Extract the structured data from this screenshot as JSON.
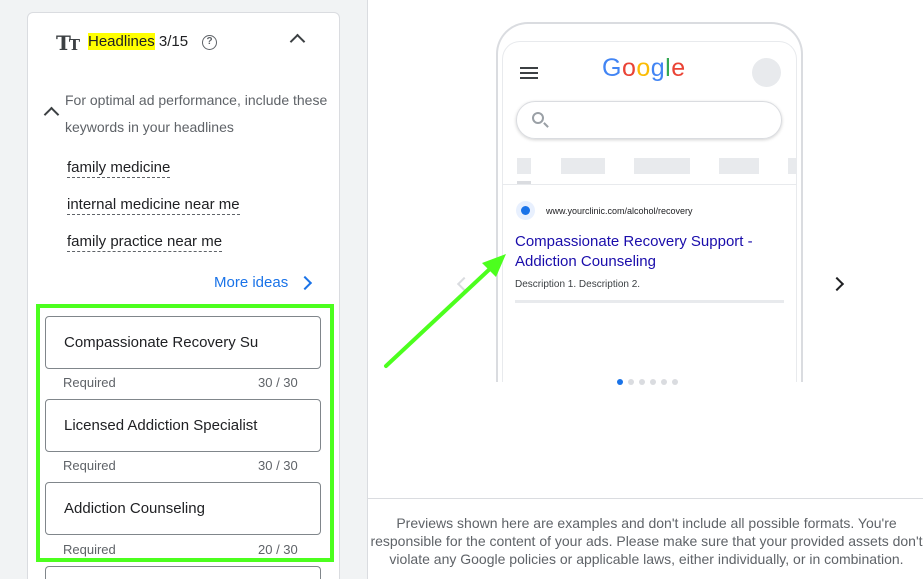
{
  "headlines": {
    "title": "Headlines",
    "count": "3/15",
    "help_icon": "?",
    "tip": "For optimal ad performance, include these keywords in your headlines",
    "keywords": [
      "family medicine",
      "internal medicine near me",
      "family practice near me"
    ],
    "more_ideas_label": "More ideas",
    "fields": [
      {
        "value": "Compassionate Recovery Support",
        "helper": "Required",
        "counter": "30 / 30"
      },
      {
        "value": "Licensed Addiction Specialists",
        "helper": "Required",
        "counter": "30 / 30"
      },
      {
        "value": "Addiction Counseling",
        "helper": "Required",
        "counter": "20 / 30"
      }
    ]
  },
  "preview": {
    "url": "www.yourclinic.com/alcohol/recovery",
    "ad_title": "Compassionate Recovery Support - Addiction Counseling",
    "ad_description": "Description 1. Description 2.",
    "disclaimer": "Previews shown here are examples and don't include all possible formats. You're responsible for the content of your ads. Please make sure that your provided assets don't violate any Google policies or applicable laws, either individually, or in combination."
  },
  "colors": {
    "highlight": "#ffff00",
    "annotation_green": "#4cff1e",
    "link_blue": "#1a73e8",
    "ad_title_blue": "#1a0dab"
  }
}
